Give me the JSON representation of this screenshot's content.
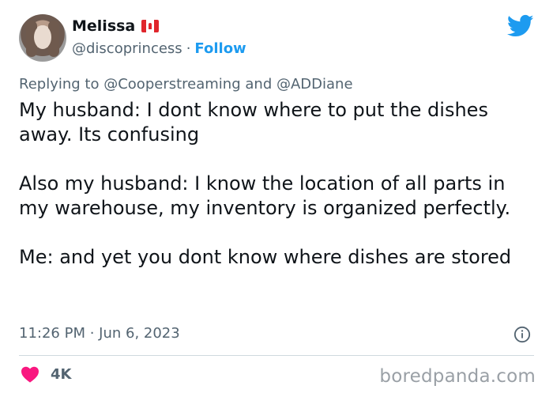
{
  "author": {
    "display_name": "Melissa",
    "flag_icon": "canada-flag-icon",
    "handle": "@discoprincess",
    "separator": "·",
    "follow_label": "Follow"
  },
  "reply": {
    "prefix": "Replying to",
    "mention_1": "@Cooperstreaming",
    "conjunction": "and",
    "mention_2": "@ADDiane"
  },
  "tweet": {
    "paragraphs": [
      "My husband: I dont know where to put the dishes away. Its confusing",
      "Also my husband: I know the location of all parts in my warehouse, my inventory is organized perfectly.",
      "Me: and yet you dont know where dishes are stored"
    ],
    "timestamp": "11:26 PM · Jun 6, 2023"
  },
  "engagement": {
    "likes": "4K"
  },
  "watermark": "boredpanda.com",
  "colors": {
    "accent": "#1d9bf0",
    "secondary_text": "#536471",
    "heart": "#f91880"
  }
}
